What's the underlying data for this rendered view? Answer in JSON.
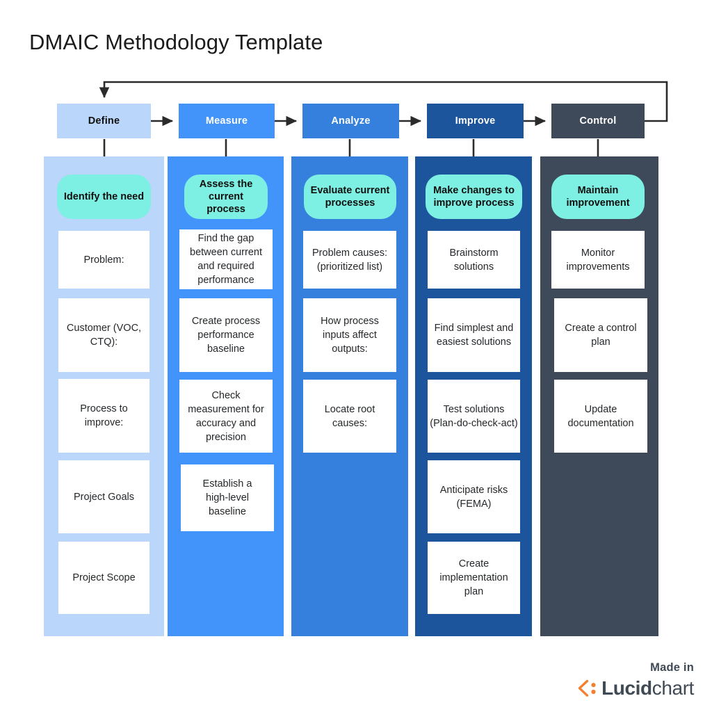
{
  "page": {
    "title": "DMAIC Methodology Template",
    "background": "#ffffff"
  },
  "colors": {
    "define": "#bad6fb",
    "measure": "#4294fb",
    "analyze": "#3580dd",
    "improve": "#1c559c",
    "control": "#3e4a59",
    "pill": "#7defe3",
    "card": "#ffffff",
    "connector": "#2b2b2b",
    "title_text": "#1b1b1b",
    "lucid_orange": "#f2802e",
    "lucid_gray": "#3f4a55"
  },
  "phases": [
    {
      "key": "define",
      "header_label": "Define",
      "header_text_color": "#10100f",
      "band_color": "#bad6fb",
      "pill_label": "Identify the need",
      "cards": [
        "Problem:",
        "Customer (VOC,\nCTQ):",
        "Process to\nimprove:",
        "Project Goals",
        "Project Scope"
      ]
    },
    {
      "key": "measure",
      "header_label": "Measure",
      "header_text_color": "#ffffff",
      "band_color": "#4294fb",
      "pill_label": "Assess the\ncurrent process",
      "cards": [
        "Find the gap\nbetween current\nand required\nperformance",
        "Create process\nperformance\nbaseline",
        "Check\nmeasurement for\naccuracy and\nprecision",
        "Establish a\nhigh-level\nbaseline"
      ]
    },
    {
      "key": "analyze",
      "header_label": "Analyze",
      "header_text_color": "#ffffff",
      "band_color": "#3580dd",
      "pill_label": "Evaluate current\nprocesses",
      "cards": [
        "Problem causes:\n(prioritized list)",
        "How process\ninputs affect\noutputs:",
        "Locate root\ncauses:"
      ]
    },
    {
      "key": "improve",
      "header_label": "Improve",
      "header_text_color": "#ffffff",
      "band_color": "#1c559c",
      "pill_label": "Make changes to\nimprove process",
      "cards": [
        "Brainstorm\nsolutions",
        "Find simplest and\neasiest solutions",
        "Test solutions\n(Plan-do-check-act)",
        "Anticipate risks\n(FEMA)",
        "Create\nimplementation\nplan"
      ]
    },
    {
      "key": "control",
      "header_label": "Control",
      "header_text_color": "#ffffff",
      "band_color": "#3e4a59",
      "pill_label": "Maintain\nimprovement",
      "cards": [
        "Monitor\nimprovements",
        "Create a control\nplan",
        "Update\ndocumentation"
      ]
    }
  ],
  "footer": {
    "made_in": "Made in",
    "brand_bold": "Lucid",
    "brand_light": "chart"
  }
}
